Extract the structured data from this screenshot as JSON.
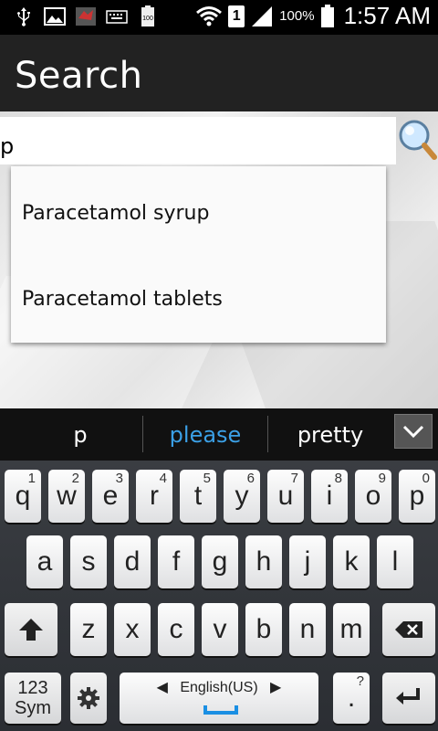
{
  "status_bar": {
    "battery_percent": "100%",
    "sim_slot": "1",
    "time": "1:57 AM",
    "icons": [
      "usb-icon",
      "gallery-icon",
      "app-notification-icon",
      "keyboard-icon",
      "battery-full-icon",
      "wifi-icon",
      "signal-icon",
      "battery-icon"
    ],
    "battery_badge": "100"
  },
  "action_bar": {
    "title": "Search"
  },
  "search": {
    "value": "p",
    "placeholder": "",
    "button_icon": "magnifier-icon"
  },
  "suggestions_dropdown": {
    "items": [
      "Paracetamol syrup",
      "Paracetamol tablets"
    ]
  },
  "keyboard_suggestions": {
    "items": [
      "p",
      "please",
      "pretty"
    ],
    "highlight_color": "#3ba0e6"
  },
  "keyboard": {
    "row1": [
      {
        "key": "q",
        "num": "1"
      },
      {
        "key": "w",
        "num": "2"
      },
      {
        "key": "e",
        "num": "3"
      },
      {
        "key": "r",
        "num": "4"
      },
      {
        "key": "t",
        "num": "5"
      },
      {
        "key": "y",
        "num": "6"
      },
      {
        "key": "u",
        "num": "7"
      },
      {
        "key": "i",
        "num": "8"
      },
      {
        "key": "o",
        "num": "9"
      },
      {
        "key": "p",
        "num": "0"
      }
    ],
    "row2": [
      "a",
      "s",
      "d",
      "f",
      "g",
      "h",
      "j",
      "k",
      "l"
    ],
    "row3": [
      "z",
      "x",
      "c",
      "v",
      "b",
      "n",
      "m"
    ],
    "sym_line1": "123",
    "sym_line2": "Sym",
    "language": "English(US)",
    "period": ".",
    "period_sup": "?"
  }
}
